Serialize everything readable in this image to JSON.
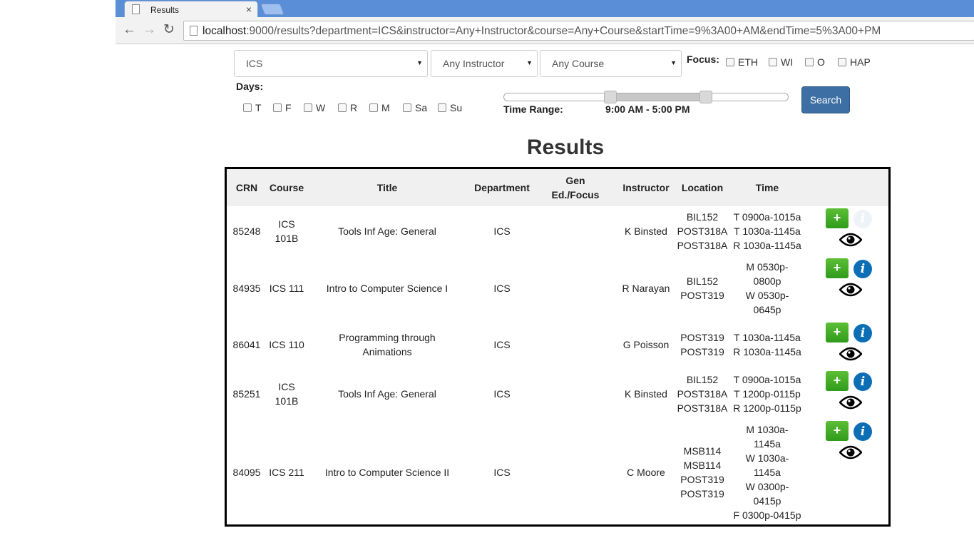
{
  "browser": {
    "tab_title": "Results",
    "tab_close": "×",
    "url_host": "localhost",
    "url_rest": ":9000/results?department=ICS&instructor=Any+Instructor&course=Any+Course&startTime=9%3A00+AM&endTime=5%3A00+PM"
  },
  "filters": {
    "department": "ICS",
    "instructor": "Any Instructor",
    "course": "Any Course",
    "focus_label": "Focus:",
    "focus_options": [
      "ETH",
      "WI",
      "O",
      "HAP"
    ],
    "days_label": "Days:",
    "day_options": [
      "T",
      "F",
      "W",
      "R",
      "M",
      "Sa",
      "Su"
    ],
    "time_range_label": "Time Range:",
    "time_range_value": "9:00 AM - 5:00 PM",
    "search_label": "Search"
  },
  "results_title": "Results",
  "table": {
    "headers": {
      "crn": "CRN",
      "course": "Course",
      "title": "Title",
      "department": "Department",
      "gen_ed_1": "Gen",
      "gen_ed_2": "Ed./Focus",
      "instructor": "Instructor",
      "location": "Location",
      "time": "Time"
    },
    "rows": [
      {
        "crn": "85248",
        "course_1": "ICS",
        "course_2": "101B",
        "title_1": "Tools Inf Age: General",
        "title_2": "",
        "department": "ICS",
        "instructor": "K Binsted",
        "location": [
          "BIL152",
          "POST318A",
          "POST318A"
        ],
        "time": [
          "T 0900a-1015a",
          "T 1030a-1145a",
          "R 1030a-1145a"
        ]
      },
      {
        "crn": "84935",
        "course_1": "ICS 111",
        "course_2": "",
        "title_1": "Intro to Computer Science I",
        "title_2": "",
        "department": "ICS",
        "instructor": "R Narayan",
        "location": [
          "BIL152",
          "POST319"
        ],
        "time": [
          "M 0530p-",
          "0800p",
          "W 0530p-",
          "0645p"
        ]
      },
      {
        "crn": "86041",
        "course_1": "ICS 110",
        "course_2": "",
        "title_1": "Programming through",
        "title_2": "Animations",
        "department": "ICS",
        "instructor": "G Poisson",
        "location": [
          "POST319",
          "POST319"
        ],
        "time": [
          "T 1030a-1145a",
          "R 1030a-1145a"
        ]
      },
      {
        "crn": "85251",
        "course_1": "ICS",
        "course_2": "101B",
        "title_1": "Tools Inf Age: General",
        "title_2": "",
        "department": "ICS",
        "instructor": "K Binsted",
        "location": [
          "BIL152",
          "POST318A",
          "POST318A"
        ],
        "time": [
          "T 0900a-1015a",
          "T 1200p-0115p",
          "R 1200p-0115p"
        ]
      },
      {
        "crn": "84095",
        "course_1": "ICS 211",
        "course_2": "",
        "title_1": "Intro to Computer Science II",
        "title_2": "",
        "department": "ICS",
        "instructor": "C Moore",
        "location": [
          "MSB114",
          "MSB114",
          "POST319",
          "POST319"
        ],
        "time": [
          "M 1030a-",
          "1145a",
          "W 1030a-",
          "1145a",
          "W 0300p-",
          "0415p",
          "F 0300p-0415p"
        ]
      }
    ],
    "add_label": "+",
    "info_label": "i"
  },
  "colors": {
    "search_button": "#3d6fa4",
    "add_button": "#3aa824",
    "info_icon": "#0c6fb6",
    "tab_strip": "#5a8fd8"
  }
}
